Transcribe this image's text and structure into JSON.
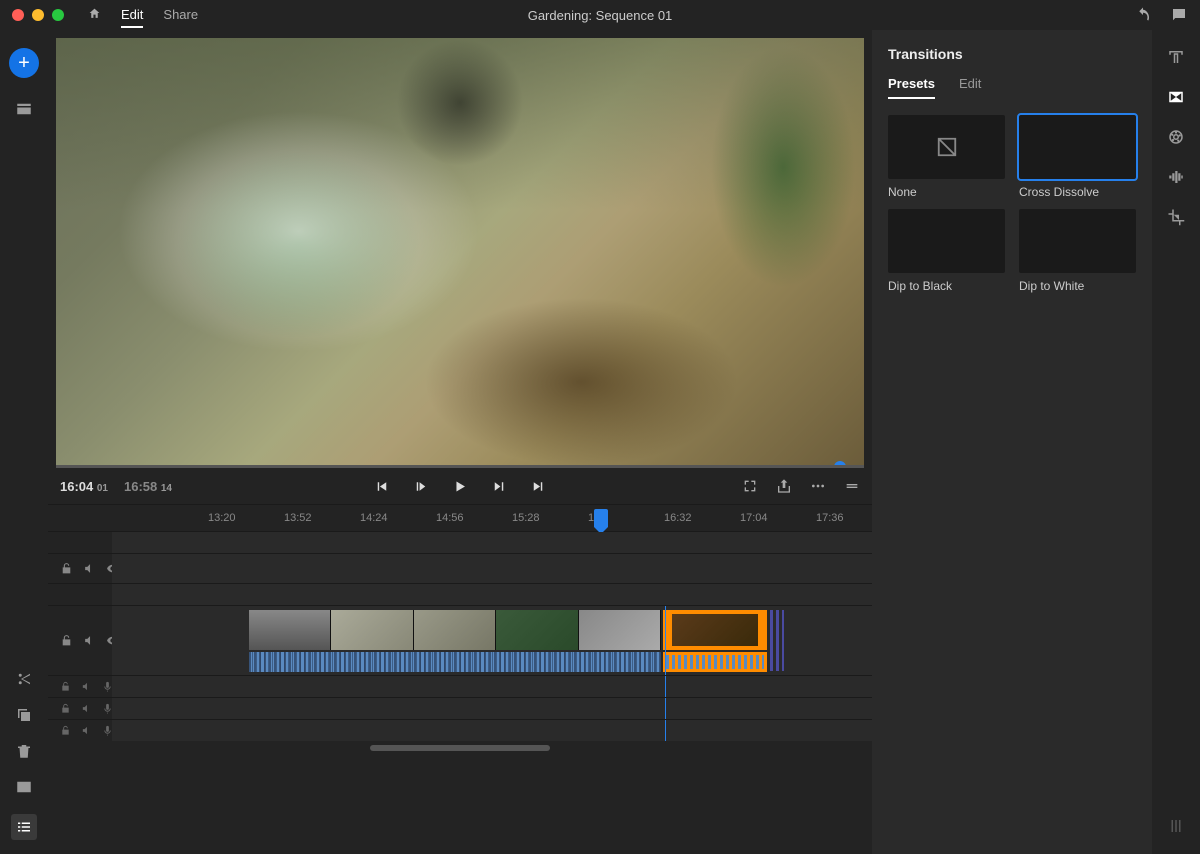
{
  "nav": {
    "home_sr": "Home",
    "edit": "Edit",
    "share": "Share"
  },
  "title": "Gardening: Sequence 01",
  "timecode": {
    "current": "16:04",
    "current_frames": "01",
    "total": "16:58",
    "total_frames": "14"
  },
  "ruler": [
    "13:20",
    "13:52",
    "14:24",
    "14:56",
    "15:28",
    "16:",
    "16:32",
    "17:04",
    "17:36"
  ],
  "panel": {
    "title": "Transitions",
    "tabs": {
      "presets": "Presets",
      "edit": "Edit"
    },
    "presets": {
      "none": "None",
      "cross": "Cross Dissolve",
      "black": "Dip to Black",
      "white": "Dip to White"
    }
  }
}
